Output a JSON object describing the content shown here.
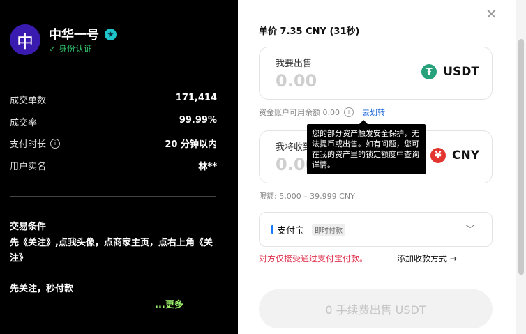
{
  "merchant": {
    "avatar_char": "中",
    "name": "中华一号",
    "verified_label": "身份认证"
  },
  "stats": [
    {
      "label": "成交单数",
      "value": "171,414"
    },
    {
      "label": "成交率",
      "value": "99.99%"
    },
    {
      "label": "支付时长",
      "value": "20 分钟以内"
    },
    {
      "label": "用户实名",
      "value": "林**"
    }
  ],
  "terms": {
    "title": "交易条件",
    "line1": "先《关注》,点我头像，点商家主页，点右上角《关注》",
    "line2": "先关注，秒付款",
    "more": "...更多"
  },
  "order": {
    "price_label": "单价 7.35 CNY (31秒)",
    "sell_box": {
      "title": "我要出售",
      "amount": "0.00",
      "currency": "USDT"
    },
    "balance_text": "资金账户可用余额 0.00",
    "transfer_link": "去划转",
    "receive_box": {
      "title": "我将收到",
      "amount": "0.00",
      "currency": "CNY"
    },
    "limit_text": "限额: 5,000 – 39,999 CNY",
    "tooltip": "您的部分资产触发安全保护，无法提币或出售。如有问题，您可在我的资产里的锁定额度中查询详情。",
    "payment": {
      "name": "支付宝",
      "tag": "即时付款"
    },
    "warning": "对方仅接受通过支付宝付款。",
    "add_payment": "添加收款方式 →",
    "submit": "0 手续费出售 USDT"
  },
  "colors": {
    "usdt": "#26a17b",
    "cny": "#e3342f",
    "verified": "#31c36a",
    "more": "#9cf36b",
    "warning": "#e0334f",
    "link": "#1a66d8"
  },
  "icons": [
    "check-icon",
    "star-badge-icon",
    "info-icon",
    "close-icon",
    "usdt-coin-icon",
    "cny-coin-icon",
    "chevron-down-icon"
  ]
}
